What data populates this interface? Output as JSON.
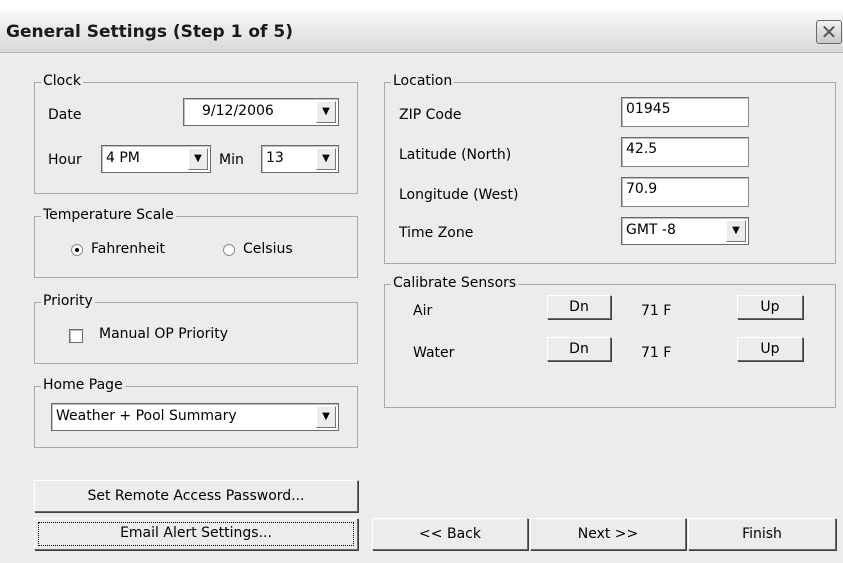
{
  "window": {
    "title": "General Settings (Step 1 of 5)",
    "close_icon": "close-icon"
  },
  "clock": {
    "legend": "Clock",
    "date_label": "Date",
    "date_value": "9/12/2006",
    "hour_label": "Hour",
    "hour_value": "4 PM",
    "min_label": "Min",
    "min_value": "13"
  },
  "temperature": {
    "legend": "Temperature Scale",
    "options": [
      "Fahrenheit",
      "Celsius"
    ],
    "selected": "Fahrenheit"
  },
  "priority": {
    "legend": "Priority",
    "manual_op_label": "Manual OP Priority",
    "checked": false
  },
  "home_page": {
    "legend": "Home Page",
    "value": "Weather + Pool Summary"
  },
  "location": {
    "legend": "Location",
    "zip_label": "ZIP Code",
    "zip_value": "01945",
    "lat_label": "Latitude (North)",
    "lat_value": "42.5",
    "lon_label": "Longitude (West)",
    "lon_value": "70.9",
    "tz_label": "Time Zone",
    "tz_value": "GMT -8"
  },
  "calibrate": {
    "legend": "Calibrate Sensors",
    "rows": [
      {
        "name": "Air",
        "down": "Dn",
        "value": "71 F",
        "up": "Up"
      },
      {
        "name": "Water",
        "down": "Dn",
        "value": "71 F",
        "up": "Up"
      }
    ]
  },
  "buttons": {
    "remote_password": "Set Remote Access Password...",
    "email_alert": "Email Alert Settings...",
    "back": "<< Back",
    "next": "Next >>",
    "finish": "Finish"
  }
}
